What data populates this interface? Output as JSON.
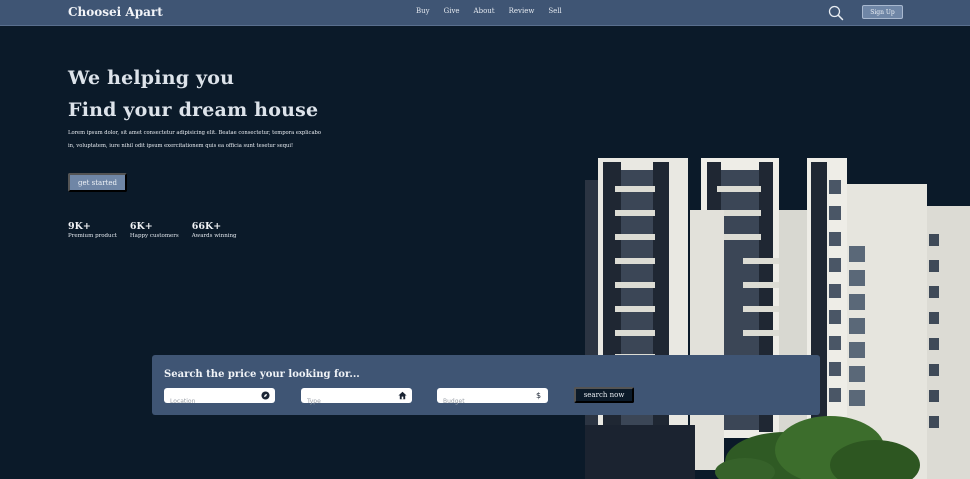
{
  "nav": {
    "brand": "Choosei Apart",
    "links": [
      "Buy",
      "Give",
      "About",
      "Review",
      "Sell"
    ],
    "signup_label": "Sign Up"
  },
  "hero": {
    "line1": "We helping you",
    "line2": "Find your dream house",
    "paragraph": "Lorem ipsum dolor, sit amet consectetur adipisicing elit. Beatae consectetur, tempora explicabo in, voluptatem, iure nihil odit ipsum exercitationem quis ea officia sunt tesetur sequi!",
    "cta_label": "get started",
    "stats": [
      {
        "value": "9K+",
        "label": "Premium product"
      },
      {
        "value": "6K+",
        "label": "Happy customers"
      },
      {
        "value": "66K+",
        "label": "Awards winning"
      }
    ]
  },
  "search": {
    "title": "Search the price your looking for...",
    "fields": [
      {
        "placeholder": "Location",
        "icon": "compass-icon"
      },
      {
        "placeholder": "Type",
        "icon": "home-icon"
      },
      {
        "placeholder": "Budget",
        "icon": "dollar-icon",
        "glyph": "$"
      }
    ],
    "button_label": "search now"
  },
  "colors": {
    "background": "#0b1a29",
    "nav": "#3f5574",
    "accent_button": "#6f86a6"
  }
}
